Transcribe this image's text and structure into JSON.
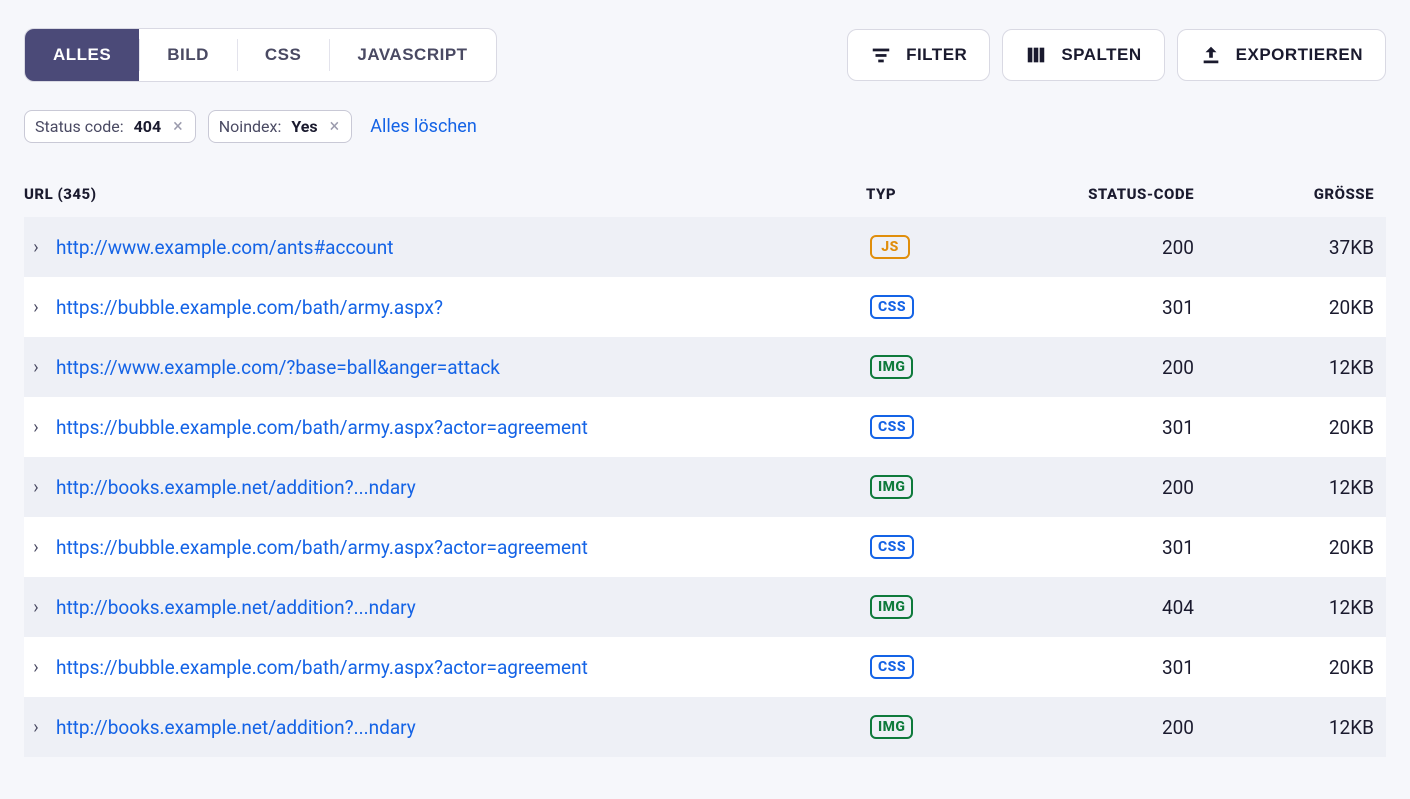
{
  "tabs": [
    {
      "label": "ALLES",
      "active": true
    },
    {
      "label": "BILD",
      "active": false
    },
    {
      "label": "CSS",
      "active": false
    },
    {
      "label": "JAVASCRIPT",
      "active": false
    }
  ],
  "buttons": {
    "filter": "FILTER",
    "columns": "SPALTEN",
    "export": "EXPORTIEREN"
  },
  "filters": [
    {
      "label": "Status code:",
      "value": "404"
    },
    {
      "label": "Noindex:",
      "value": "Yes"
    }
  ],
  "clearAll": "Alles löschen",
  "columns": {
    "url": "URL (345)",
    "type": "TYP",
    "status": "STATUS-CODE",
    "size": "GRÖSSE"
  },
  "rows": [
    {
      "url": "http://www.example.com/ants#account",
      "type": "JS",
      "status": "200",
      "size": "37KB"
    },
    {
      "url": "https://bubble.example.com/bath/army.aspx?",
      "type": "CSS",
      "status": "301",
      "size": "20KB"
    },
    {
      "url": "https://www.example.com/?base=ball&anger=attack",
      "type": "IMG",
      "status": "200",
      "size": "12KB"
    },
    {
      "url": "https://bubble.example.com/bath/army.aspx?actor=agreement",
      "type": "CSS",
      "status": "301",
      "size": "20KB"
    },
    {
      "url": "http://books.example.net/addition?...ndary",
      "type": "IMG",
      "status": "200",
      "size": "12KB"
    },
    {
      "url": "https://bubble.example.com/bath/army.aspx?actor=agreement",
      "type": "CSS",
      "status": "301",
      "size": "20KB"
    },
    {
      "url": "http://books.example.net/addition?...ndary",
      "type": "IMG",
      "status": "404",
      "size": "12KB"
    },
    {
      "url": "https://bubble.example.com/bath/army.aspx?actor=agreement",
      "type": "CSS",
      "status": "301",
      "size": "20KB"
    },
    {
      "url": "http://books.example.net/addition?...ndary",
      "type": "IMG",
      "status": "200",
      "size": "12KB"
    }
  ],
  "typeBadgeClass": {
    "JS": "js",
    "CSS": "css",
    "IMG": "img"
  }
}
